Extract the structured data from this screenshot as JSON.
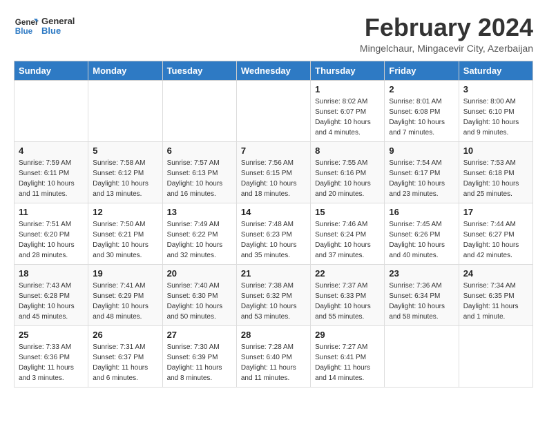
{
  "header": {
    "logo_text_general": "General",
    "logo_text_blue": "Blue",
    "month_title": "February 2024",
    "location": "Mingelchaur, Mingacevir City, Azerbaijan"
  },
  "days_of_week": [
    "Sunday",
    "Monday",
    "Tuesday",
    "Wednesday",
    "Thursday",
    "Friday",
    "Saturday"
  ],
  "weeks": [
    [
      {
        "day": "",
        "sunrise": "",
        "sunset": "",
        "daylight": ""
      },
      {
        "day": "",
        "sunrise": "",
        "sunset": "",
        "daylight": ""
      },
      {
        "day": "",
        "sunrise": "",
        "sunset": "",
        "daylight": ""
      },
      {
        "day": "",
        "sunrise": "",
        "sunset": "",
        "daylight": ""
      },
      {
        "day": "1",
        "sunrise": "Sunrise: 8:02 AM",
        "sunset": "Sunset: 6:07 PM",
        "daylight": "Daylight: 10 hours and 4 minutes."
      },
      {
        "day": "2",
        "sunrise": "Sunrise: 8:01 AM",
        "sunset": "Sunset: 6:08 PM",
        "daylight": "Daylight: 10 hours and 7 minutes."
      },
      {
        "day": "3",
        "sunrise": "Sunrise: 8:00 AM",
        "sunset": "Sunset: 6:10 PM",
        "daylight": "Daylight: 10 hours and 9 minutes."
      }
    ],
    [
      {
        "day": "4",
        "sunrise": "Sunrise: 7:59 AM",
        "sunset": "Sunset: 6:11 PM",
        "daylight": "Daylight: 10 hours and 11 minutes."
      },
      {
        "day": "5",
        "sunrise": "Sunrise: 7:58 AM",
        "sunset": "Sunset: 6:12 PM",
        "daylight": "Daylight: 10 hours and 13 minutes."
      },
      {
        "day": "6",
        "sunrise": "Sunrise: 7:57 AM",
        "sunset": "Sunset: 6:13 PM",
        "daylight": "Daylight: 10 hours and 16 minutes."
      },
      {
        "day": "7",
        "sunrise": "Sunrise: 7:56 AM",
        "sunset": "Sunset: 6:15 PM",
        "daylight": "Daylight: 10 hours and 18 minutes."
      },
      {
        "day": "8",
        "sunrise": "Sunrise: 7:55 AM",
        "sunset": "Sunset: 6:16 PM",
        "daylight": "Daylight: 10 hours and 20 minutes."
      },
      {
        "day": "9",
        "sunrise": "Sunrise: 7:54 AM",
        "sunset": "Sunset: 6:17 PM",
        "daylight": "Daylight: 10 hours and 23 minutes."
      },
      {
        "day": "10",
        "sunrise": "Sunrise: 7:53 AM",
        "sunset": "Sunset: 6:18 PM",
        "daylight": "Daylight: 10 hours and 25 minutes."
      }
    ],
    [
      {
        "day": "11",
        "sunrise": "Sunrise: 7:51 AM",
        "sunset": "Sunset: 6:20 PM",
        "daylight": "Daylight: 10 hours and 28 minutes."
      },
      {
        "day": "12",
        "sunrise": "Sunrise: 7:50 AM",
        "sunset": "Sunset: 6:21 PM",
        "daylight": "Daylight: 10 hours and 30 minutes."
      },
      {
        "day": "13",
        "sunrise": "Sunrise: 7:49 AM",
        "sunset": "Sunset: 6:22 PM",
        "daylight": "Daylight: 10 hours and 32 minutes."
      },
      {
        "day": "14",
        "sunrise": "Sunrise: 7:48 AM",
        "sunset": "Sunset: 6:23 PM",
        "daylight": "Daylight: 10 hours and 35 minutes."
      },
      {
        "day": "15",
        "sunrise": "Sunrise: 7:46 AM",
        "sunset": "Sunset: 6:24 PM",
        "daylight": "Daylight: 10 hours and 37 minutes."
      },
      {
        "day": "16",
        "sunrise": "Sunrise: 7:45 AM",
        "sunset": "Sunset: 6:26 PM",
        "daylight": "Daylight: 10 hours and 40 minutes."
      },
      {
        "day": "17",
        "sunrise": "Sunrise: 7:44 AM",
        "sunset": "Sunset: 6:27 PM",
        "daylight": "Daylight: 10 hours and 42 minutes."
      }
    ],
    [
      {
        "day": "18",
        "sunrise": "Sunrise: 7:43 AM",
        "sunset": "Sunset: 6:28 PM",
        "daylight": "Daylight: 10 hours and 45 minutes."
      },
      {
        "day": "19",
        "sunrise": "Sunrise: 7:41 AM",
        "sunset": "Sunset: 6:29 PM",
        "daylight": "Daylight: 10 hours and 48 minutes."
      },
      {
        "day": "20",
        "sunrise": "Sunrise: 7:40 AM",
        "sunset": "Sunset: 6:30 PM",
        "daylight": "Daylight: 10 hours and 50 minutes."
      },
      {
        "day": "21",
        "sunrise": "Sunrise: 7:38 AM",
        "sunset": "Sunset: 6:32 PM",
        "daylight": "Daylight: 10 hours and 53 minutes."
      },
      {
        "day": "22",
        "sunrise": "Sunrise: 7:37 AM",
        "sunset": "Sunset: 6:33 PM",
        "daylight": "Daylight: 10 hours and 55 minutes."
      },
      {
        "day": "23",
        "sunrise": "Sunrise: 7:36 AM",
        "sunset": "Sunset: 6:34 PM",
        "daylight": "Daylight: 10 hours and 58 minutes."
      },
      {
        "day": "24",
        "sunrise": "Sunrise: 7:34 AM",
        "sunset": "Sunset: 6:35 PM",
        "daylight": "Daylight: 11 hours and 1 minute."
      }
    ],
    [
      {
        "day": "25",
        "sunrise": "Sunrise: 7:33 AM",
        "sunset": "Sunset: 6:36 PM",
        "daylight": "Daylight: 11 hours and 3 minutes."
      },
      {
        "day": "26",
        "sunrise": "Sunrise: 7:31 AM",
        "sunset": "Sunset: 6:37 PM",
        "daylight": "Daylight: 11 hours and 6 minutes."
      },
      {
        "day": "27",
        "sunrise": "Sunrise: 7:30 AM",
        "sunset": "Sunset: 6:39 PM",
        "daylight": "Daylight: 11 hours and 8 minutes."
      },
      {
        "day": "28",
        "sunrise": "Sunrise: 7:28 AM",
        "sunset": "Sunset: 6:40 PM",
        "daylight": "Daylight: 11 hours and 11 minutes."
      },
      {
        "day": "29",
        "sunrise": "Sunrise: 7:27 AM",
        "sunset": "Sunset: 6:41 PM",
        "daylight": "Daylight: 11 hours and 14 minutes."
      },
      {
        "day": "",
        "sunrise": "",
        "sunset": "",
        "daylight": ""
      },
      {
        "day": "",
        "sunrise": "",
        "sunset": "",
        "daylight": ""
      }
    ]
  ]
}
